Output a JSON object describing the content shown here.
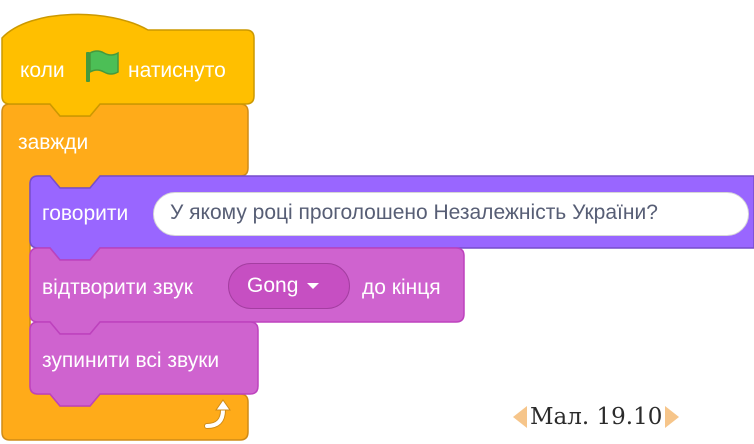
{
  "colors": {
    "events": "#ffbf00",
    "control": "#ffab19",
    "looks": "#9966ff",
    "sound": "#cf63cf",
    "flag": "#4cbf56",
    "caption_arrow": "#f6c58a"
  },
  "hat_block": {
    "label_before": "коли",
    "icon": "green-flag-icon",
    "label_after": "натиснуто"
  },
  "forever_block": {
    "label": "завжди",
    "icon": "loop-arrow-icon"
  },
  "say_block": {
    "label": "говорити",
    "input_value": "У якому році проголошено Незалежність України?"
  },
  "play_sound_block": {
    "label": "відтворити звук",
    "sound_value": "Gong",
    "label_after": "до кінця"
  },
  "stop_sounds_block": {
    "label": "зупинити всі звуки"
  },
  "caption": {
    "text": "Мал. 19.10"
  }
}
